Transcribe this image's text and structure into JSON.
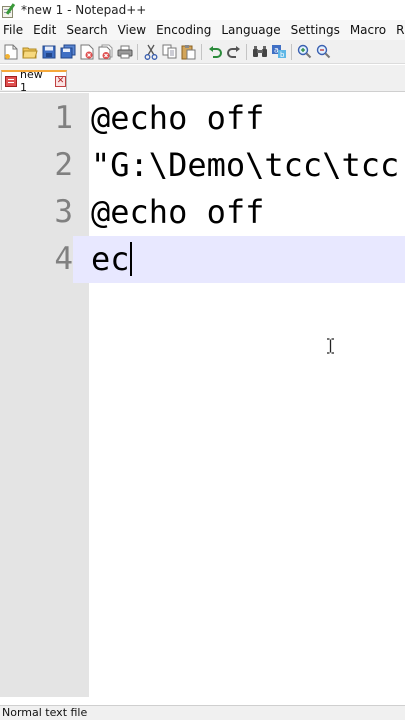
{
  "window": {
    "title": "*new 1 - Notepad++"
  },
  "menu": {
    "items": [
      "File",
      "Edit",
      "Search",
      "View",
      "Encoding",
      "Language",
      "Settings",
      "Macro",
      "Ru"
    ]
  },
  "toolbar": {
    "icons": [
      "new-file-icon",
      "open-file-icon",
      "save-icon",
      "save-all-icon",
      "close-icon",
      "close-all-icon",
      "print-icon",
      "cut-icon",
      "copy-icon",
      "paste-icon",
      "undo-icon",
      "redo-icon",
      "find-icon",
      "replace-icon",
      "zoom-in-icon",
      "zoom-out-icon"
    ]
  },
  "tabs": [
    {
      "label": "new 1",
      "active": true
    }
  ],
  "editor": {
    "lines": [
      {
        "number": "1",
        "text": "@echo off"
      },
      {
        "number": "2",
        "text": "\"G:\\Demo\\tcc\\tcc"
      },
      {
        "number": "3",
        "text": "@echo off"
      },
      {
        "number": "4",
        "text": "ec"
      }
    ],
    "active_line": 4,
    "colors": {
      "gutter": "#e4e4e4",
      "active_line": "#e8e8ff",
      "line_number": "#808080"
    }
  },
  "statusbar": {
    "text": "Normal text file"
  }
}
